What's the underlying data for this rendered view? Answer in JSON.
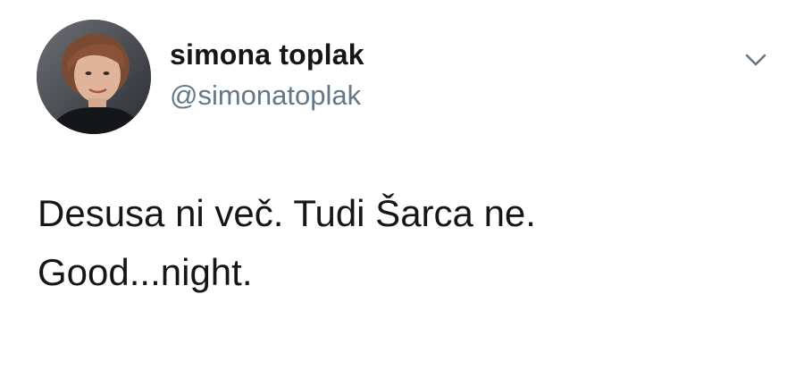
{
  "author": {
    "display_name": "simona toplak",
    "handle": "@simonatoplak",
    "avatar_icon": "user-avatar-photo"
  },
  "menu": {
    "icon": "chevron-down-icon"
  },
  "tweet": {
    "lines": [
      "Desusa ni več. Tudi Šarca ne.",
      "Good...night."
    ]
  },
  "colors": {
    "text_primary": "#14171a",
    "text_secondary": "#657786",
    "background": "#ffffff"
  }
}
